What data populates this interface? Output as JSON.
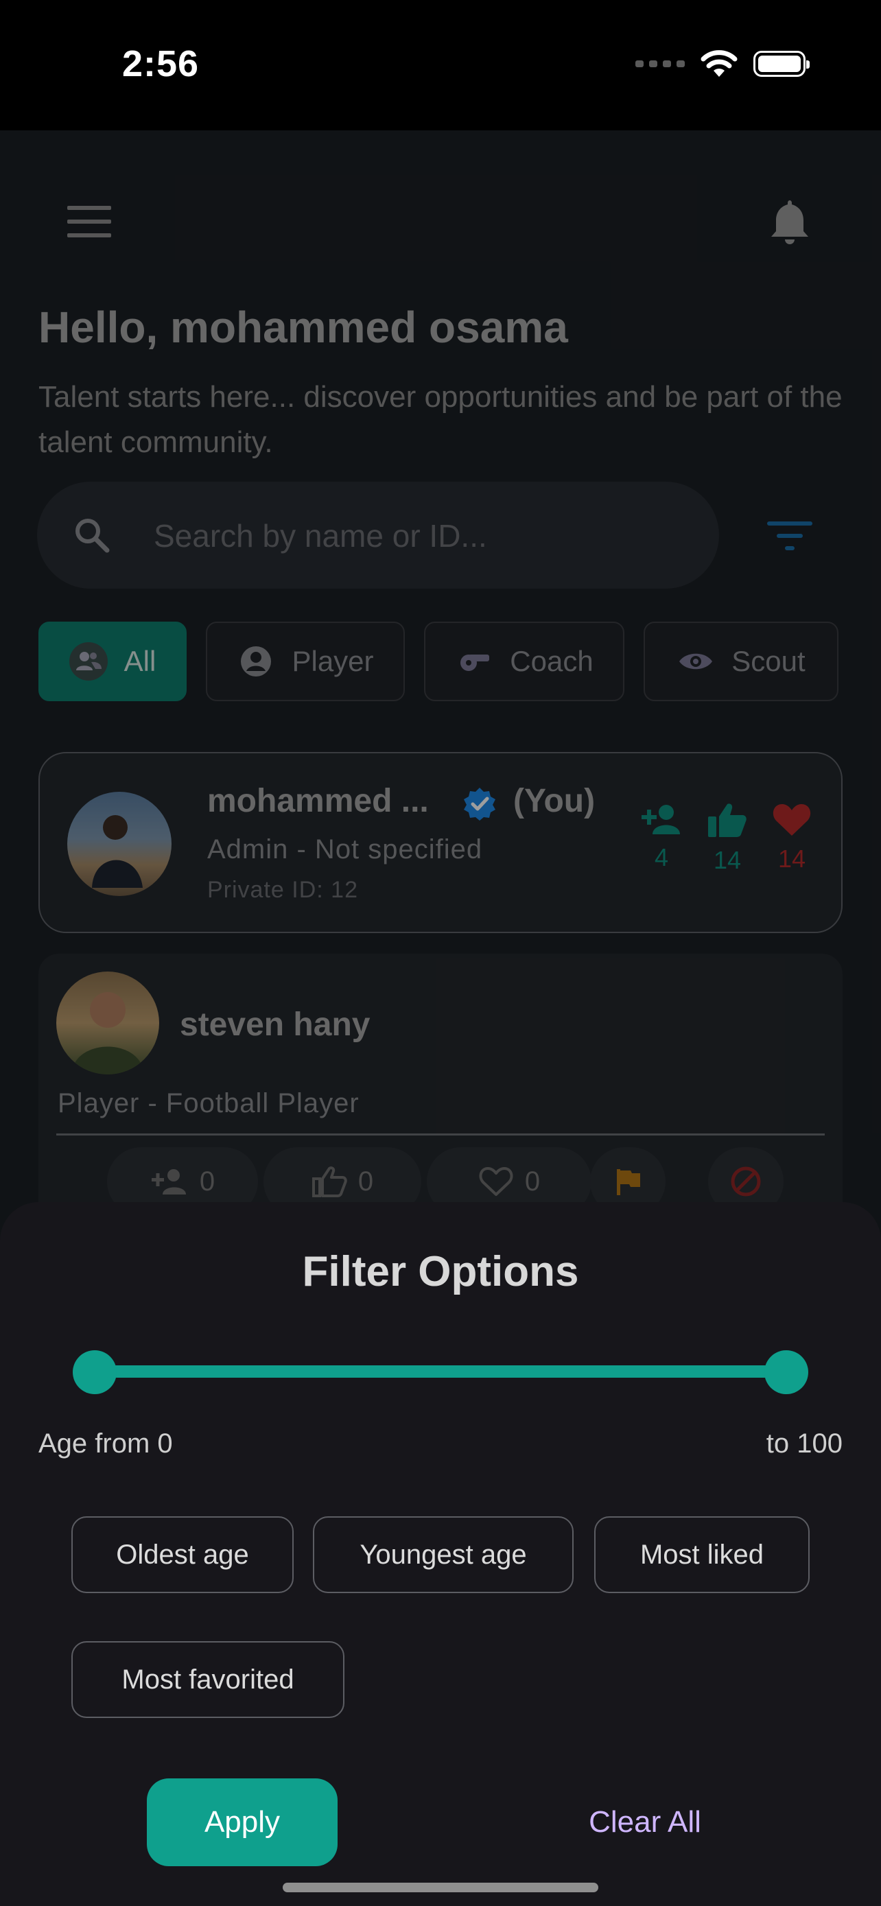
{
  "status_bar": {
    "time": "2:56"
  },
  "header": {
    "greeting": "Hello, mohammed osama",
    "tagline": "Talent starts here... discover opportunities and be part of the talent community."
  },
  "search": {
    "placeholder": "Search by name or ID..."
  },
  "chips": [
    {
      "label": "All",
      "icon": "people-icon",
      "active": true
    },
    {
      "label": "Player",
      "icon": "account-circle-icon",
      "active": false
    },
    {
      "label": "Coach",
      "icon": "whistle-icon",
      "active": false
    },
    {
      "label": "Scout",
      "icon": "eye-icon",
      "active": false
    }
  ],
  "cards": [
    {
      "name": "mohammed ...",
      "you_label": "(You)",
      "role": "Admin - Not specified",
      "private_id": "Private ID: 12",
      "followers": "4",
      "likes": "14",
      "favorites": "14"
    },
    {
      "name": "steven hany",
      "role": "Player - Football Player",
      "followers": "0",
      "likes": "0",
      "favorites": "0"
    }
  ],
  "filter_sheet": {
    "title": "Filter Options",
    "age_min": 0,
    "age_max": 100,
    "age_from_label": "Age from 0",
    "age_to_label": "to 100",
    "sort_options": [
      "Oldest age",
      "Youngest age",
      "Most liked",
      "Most favorited"
    ],
    "apply_label": "Apply",
    "clear_label": "Clear All"
  },
  "colors": {
    "accent": "#0fa08d",
    "verified": "#1e88e5",
    "heart": "#c62828",
    "flag": "#f5a623",
    "clear_text": "#cfb6ff"
  }
}
